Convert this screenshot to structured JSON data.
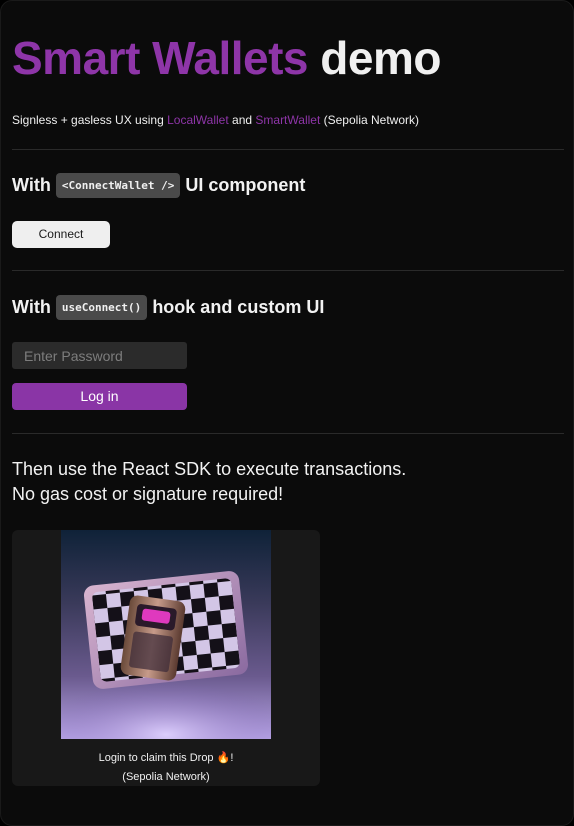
{
  "header": {
    "title_accent": "Smart Wallets",
    "title_plain": "demo",
    "subtitle_prefix": "Signless + gasless UX using ",
    "subtitle_link1": "LocalWallet",
    "subtitle_and": " and ",
    "subtitle_link2": "SmartWallet",
    "subtitle_suffix": " (Sepolia Network)"
  },
  "section_component": {
    "with": "With",
    "code": "<ConnectWallet />",
    "rest": "UI component",
    "connect_label": "Connect"
  },
  "section_hook": {
    "with": "With",
    "code": "useConnect()",
    "rest": "hook and custom UI",
    "password_placeholder": "Enter Password",
    "login_label": "Log in"
  },
  "section_sdk": {
    "line1": "Then use the React SDK to execute transactions.",
    "line2": "No gas cost or signature required!"
  },
  "drop_card": {
    "line1": "Login to claim this Drop",
    "emoji": "🔥",
    "exclaim": "!",
    "line2": "(Sepolia Network)"
  },
  "colors": {
    "accent": "#8e35a8",
    "background": "#0b0b0b",
    "button_login": "#8a35a6"
  }
}
